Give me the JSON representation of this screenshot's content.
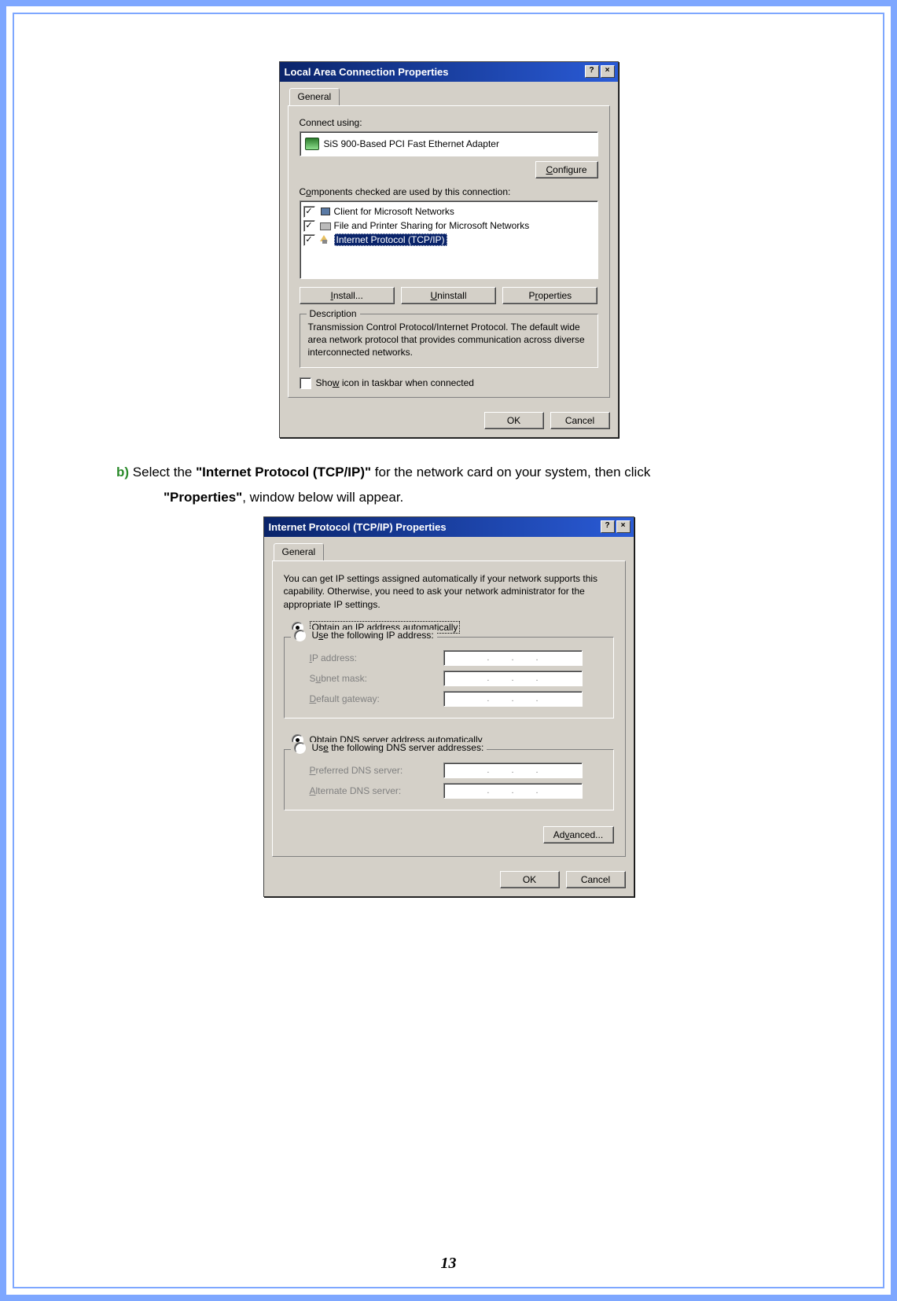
{
  "page_number": "13",
  "instruction": {
    "bullet": "b)",
    "pre": " Select the ",
    "bold1": "\"Internet Protocol (TCP/IP)\"",
    "mid1": " for the network card on your system, then click ",
    "bold2": "\"Properties\"",
    "post": ", window below will appear."
  },
  "dialog1": {
    "title": "Local Area Connection Properties",
    "help_glyph": "?",
    "close_glyph": "×",
    "tab": "General",
    "connect_using_label": "Connect using:",
    "adapter": "SiS 900-Based PCI Fast Ethernet Adapter",
    "configure_btn": "Configure",
    "components_label": "Components checked are used by this connection:",
    "components": [
      {
        "label": "Client for Microsoft Networks",
        "checked": "✓",
        "icon": "net"
      },
      {
        "label": "File and Printer Sharing for Microsoft Networks",
        "checked": "✓",
        "icon": "printer"
      },
      {
        "label": "Internet Protocol (TCP/IP)",
        "checked": "✓",
        "icon": "tcp",
        "selected": true
      }
    ],
    "install_btn": "Install...",
    "uninstall_btn": "Uninstall",
    "properties_btn": "Properties",
    "desc_legend": "Description",
    "desc_text": "Transmission Control Protocol/Internet Protocol. The default wide area network protocol that provides communication across diverse interconnected networks.",
    "show_icon_label": "Show icon in taskbar when connected",
    "ok_btn": "OK",
    "cancel_btn": "Cancel"
  },
  "dialog2": {
    "title": "Internet Protocol (TCP/IP) Properties",
    "help_glyph": "?",
    "close_glyph": "×",
    "tab": "General",
    "intro": "You can get IP settings assigned automatically if your network supports this capability. Otherwise, you need to ask your network administrator for the appropriate IP settings.",
    "r_obtain_ip": "Obtain an IP address automatically",
    "r_use_ip": "Use the following IP address:",
    "ip_label": "IP address:",
    "subnet_label": "Subnet mask:",
    "gateway_label": "Default gateway:",
    "r_obtain_dns": "Obtain DNS server address automatically",
    "r_use_dns": "Use the following DNS server addresses:",
    "pref_dns_label": "Preferred DNS server:",
    "alt_dns_label": "Alternate DNS server:",
    "advanced_btn": "Advanced...",
    "ok_btn": "OK",
    "cancel_btn": "Cancel"
  }
}
